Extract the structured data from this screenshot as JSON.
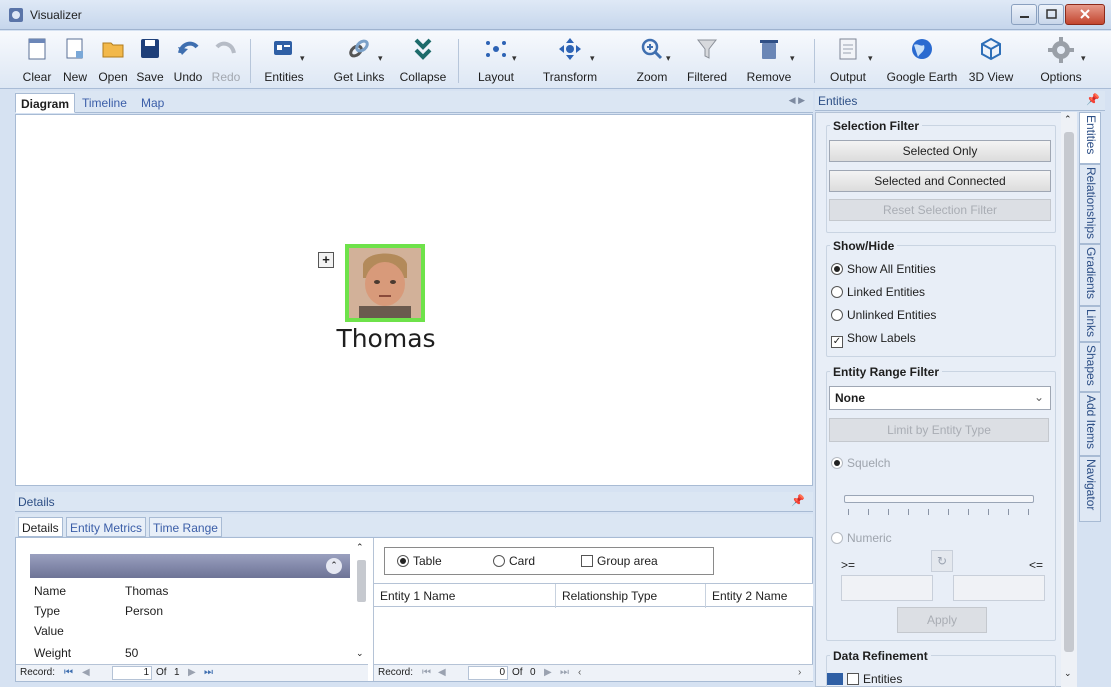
{
  "window": {
    "title": "Visualizer"
  },
  "toolbar": {
    "clear": "Clear",
    "new": "New",
    "open": "Open",
    "save": "Save",
    "undo": "Undo",
    "redo": "Redo",
    "entities": "Entities",
    "get_links": "Get Links",
    "collapse": "Collapse",
    "layout": "Layout",
    "transform": "Transform",
    "zoom": "Zoom",
    "filtered": "Filtered",
    "remove": "Remove",
    "output": "Output",
    "google_earth": "Google Earth",
    "view_3d": "3D View",
    "options": "Options"
  },
  "doc_tabs": {
    "diagram": "Diagram",
    "timeline": "Timeline",
    "map": "Map"
  },
  "diagram": {
    "entity_label": "Thomas"
  },
  "details": {
    "header": "Details",
    "tabs": {
      "details": "Details",
      "entity_metrics": "Entity Metrics",
      "time_range": "Time Range"
    },
    "properties": [
      {
        "key": "Name",
        "value": "Thomas"
      },
      {
        "key": "Type",
        "value": "Person"
      },
      {
        "key": "Value",
        "value": ""
      },
      {
        "key": "Weight",
        "value": "50"
      }
    ],
    "record_left": {
      "label": "Record:",
      "current": "1",
      "of": "Of",
      "total": "1"
    },
    "record_right": {
      "label": "Record:",
      "current": "0",
      "of": "Of",
      "total": "0"
    },
    "view_options": {
      "table": "Table",
      "card": "Card",
      "group_area": "Group area"
    },
    "grid_columns": [
      "Entity 1 Name",
      "Relationship Type",
      "Entity 2 Name"
    ]
  },
  "side": {
    "header": "Entities",
    "selection_filter": {
      "title": "Selection Filter",
      "selected_only": "Selected Only",
      "selected_connected": "Selected and Connected",
      "reset": "Reset Selection Filter"
    },
    "show_hide": {
      "title": "Show/Hide",
      "all": "Show All Entities",
      "linked": "Linked Entities",
      "unlinked": "Unlinked Entities",
      "labels": "Show Labels"
    },
    "range_filter": {
      "title": "Entity Range Filter",
      "select_value": "None",
      "limit_btn": "Limit by Entity Type",
      "squelch": "Squelch",
      "numeric": "Numeric",
      "gte": ">=",
      "lte": "<=",
      "apply": "Apply"
    },
    "data_refinement": {
      "title": "Data Refinement",
      "entities": "Entities"
    },
    "vertical_tabs": [
      "Entities",
      "Relationships",
      "Gradients",
      "Links",
      "Shapes",
      "Add Items",
      "Navigator"
    ]
  },
  "colors": {
    "accent": "#3b5ea8",
    "highlight_border": "#6ee24a"
  }
}
